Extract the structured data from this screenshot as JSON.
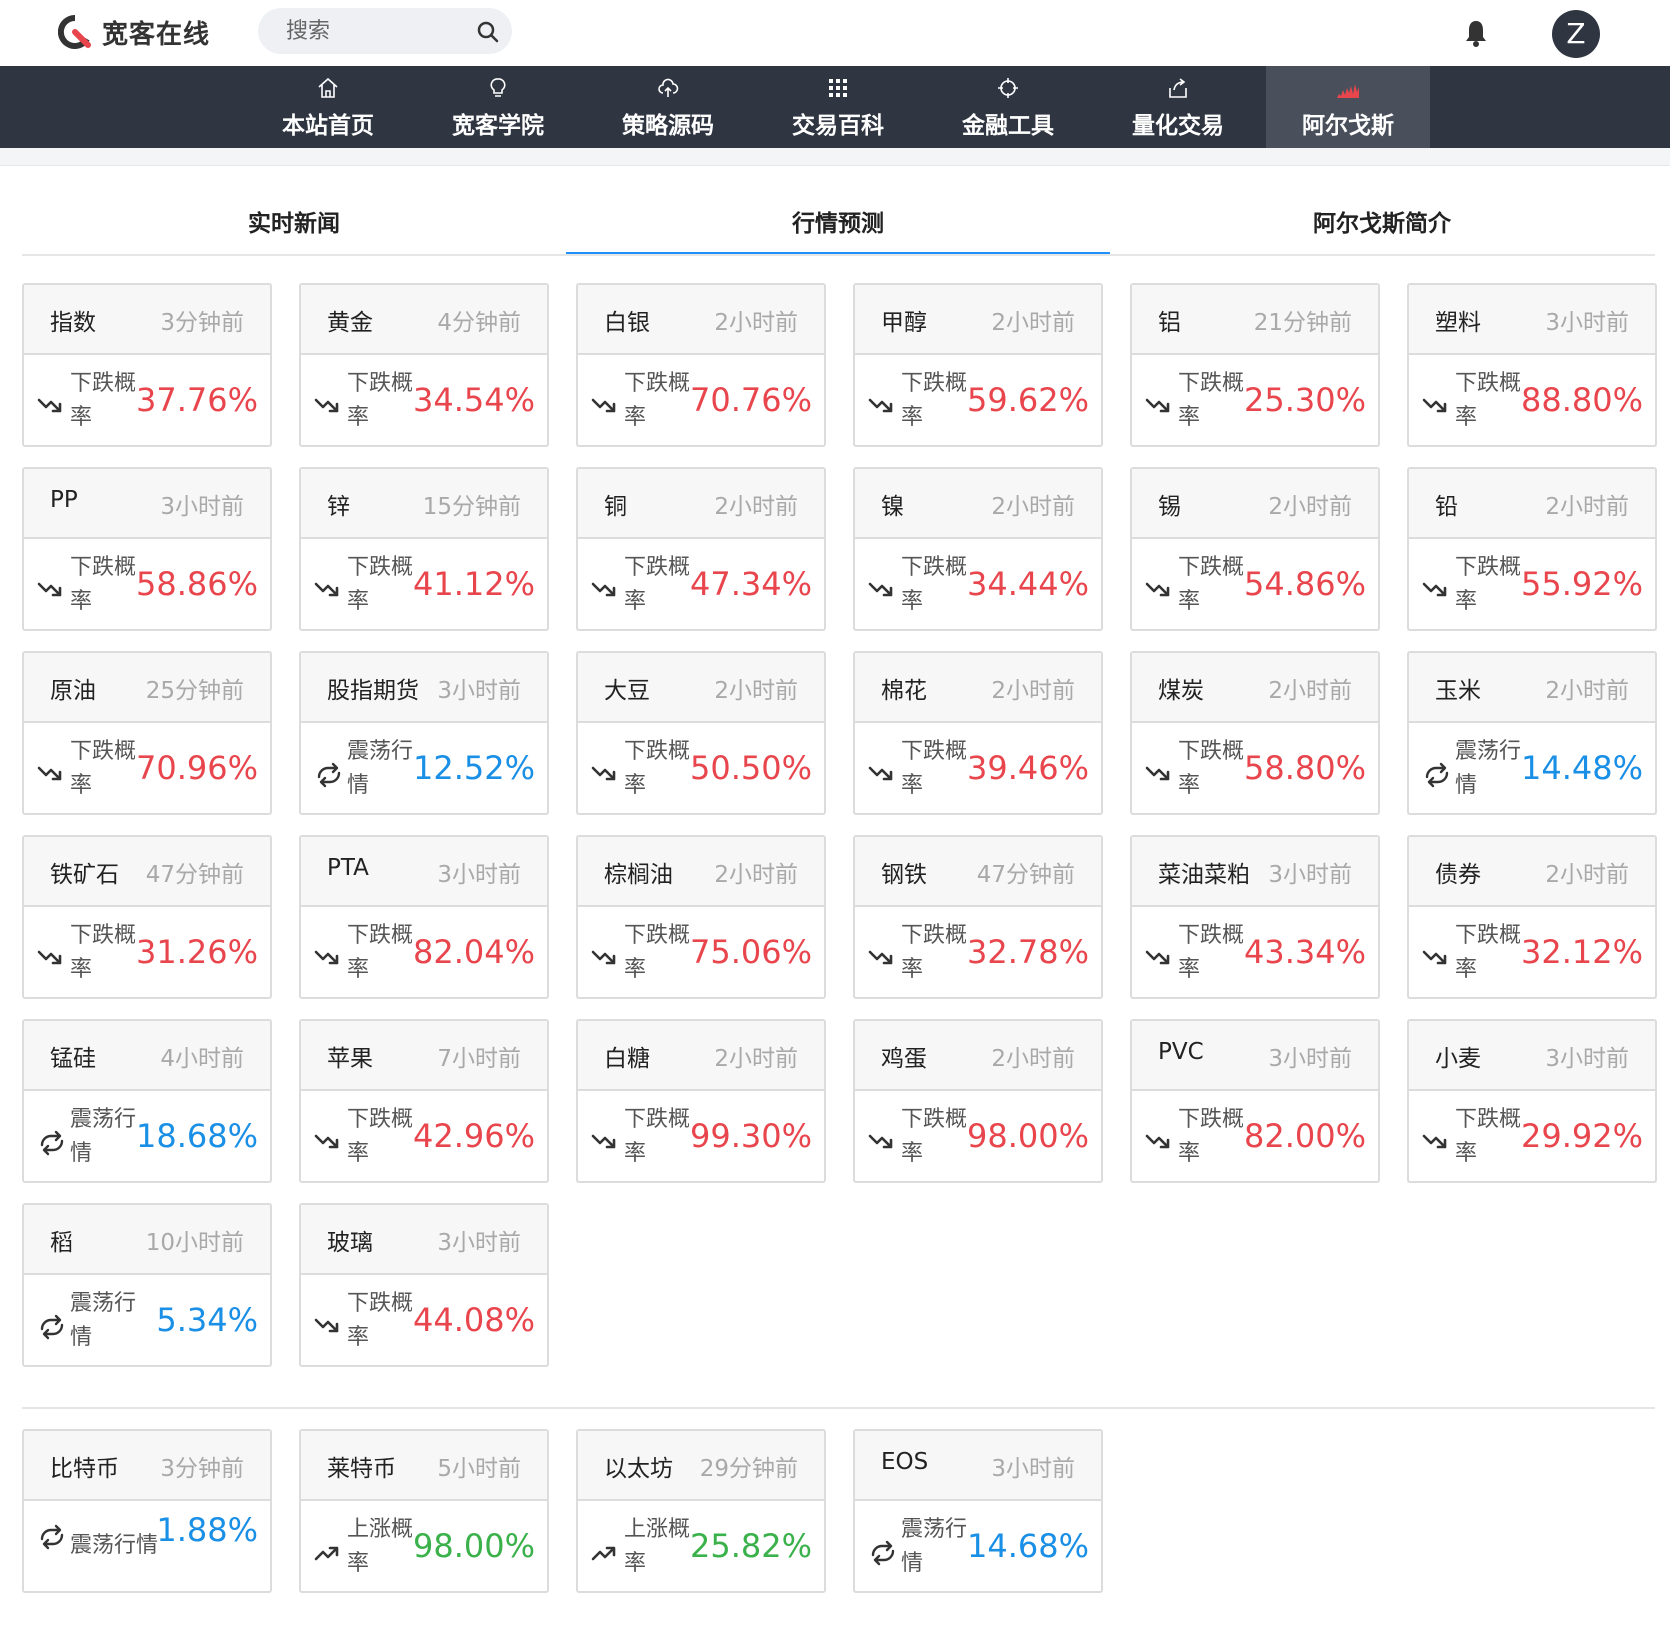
{
  "brand": {
    "name": "宽客在线"
  },
  "search": {
    "placeholder": "搜索"
  },
  "user": {
    "initial": "Z"
  },
  "nav": [
    {
      "label": "本站首页",
      "icon": "home-icon"
    },
    {
      "label": "宽客学院",
      "icon": "lightbulb-icon"
    },
    {
      "label": "策略源码",
      "icon": "cloud-upload-icon"
    },
    {
      "label": "交易百科",
      "icon": "grid-icon"
    },
    {
      "label": "金融工具",
      "icon": "crosshair-icon"
    },
    {
      "label": "量化交易",
      "icon": "share-icon"
    },
    {
      "label": "阿尔戈斯",
      "icon": "argos-chart-icon",
      "active": true
    }
  ],
  "tabs": [
    {
      "label": "实时新闻"
    },
    {
      "label": "行情预测",
      "active": true
    },
    {
      "label": "阿尔戈斯简介"
    }
  ],
  "colors": {
    "down": "#e8454d",
    "oscillate": "#1a8fe6",
    "up": "#3ab14a",
    "nav_bg": "#2f3541"
  },
  "cards": [
    {
      "name": "指数",
      "time": "3分钟前",
      "type": "down",
      "label": "下跌概率",
      "value": "37.76%"
    },
    {
      "name": "黄金",
      "time": "4分钟前",
      "type": "down",
      "label": "下跌概率",
      "value": "34.54%"
    },
    {
      "name": "白银",
      "time": "2小时前",
      "type": "down",
      "label": "下跌概率",
      "value": "70.76%"
    },
    {
      "name": "甲醇",
      "time": "2小时前",
      "type": "down",
      "label": "下跌概率",
      "value": "59.62%"
    },
    {
      "name": "铝",
      "time": "21分钟前",
      "type": "down",
      "label": "下跌概率",
      "value": "25.30%"
    },
    {
      "name": "塑料",
      "time": "3小时前",
      "type": "down",
      "label": "下跌概率",
      "value": "88.80%"
    },
    {
      "name": "PP",
      "time": "3小时前",
      "type": "down",
      "label": "下跌概率",
      "value": "58.86%"
    },
    {
      "name": "锌",
      "time": "15分钟前",
      "type": "down",
      "label": "下跌概率",
      "value": "41.12%"
    },
    {
      "name": "铜",
      "time": "2小时前",
      "type": "down",
      "label": "下跌概率",
      "value": "47.34%"
    },
    {
      "name": "镍",
      "time": "2小时前",
      "type": "down",
      "label": "下跌概率",
      "value": "34.44%"
    },
    {
      "name": "锡",
      "time": "2小时前",
      "type": "down",
      "label": "下跌概率",
      "value": "54.86%"
    },
    {
      "name": "铅",
      "time": "2小时前",
      "type": "down",
      "label": "下跌概率",
      "value": "55.92%"
    },
    {
      "name": "原油",
      "time": "25分钟前",
      "type": "down",
      "label": "下跌概率",
      "value": "70.96%"
    },
    {
      "name": "股指期货",
      "time": "3小时前",
      "type": "osc",
      "label": "震荡行情",
      "value": "12.52%"
    },
    {
      "name": "大豆",
      "time": "2小时前",
      "type": "down",
      "label": "下跌概率",
      "value": "50.50%"
    },
    {
      "name": "棉花",
      "time": "2小时前",
      "type": "down",
      "label": "下跌概率",
      "value": "39.46%"
    },
    {
      "name": "煤炭",
      "time": "2小时前",
      "type": "down",
      "label": "下跌概率",
      "value": "58.80%"
    },
    {
      "name": "玉米",
      "time": "2小时前",
      "type": "osc",
      "label": "震荡行情",
      "value": "14.48%"
    },
    {
      "name": "铁矿石",
      "time": "47分钟前",
      "type": "down",
      "label": "下跌概率",
      "value": "31.26%"
    },
    {
      "name": "PTA",
      "time": "3小时前",
      "type": "down",
      "label": "下跌概率",
      "value": "82.04%"
    },
    {
      "name": "棕榈油",
      "time": "2小时前",
      "type": "down",
      "label": "下跌概率",
      "value": "75.06%"
    },
    {
      "name": "钢铁",
      "time": "47分钟前",
      "type": "down",
      "label": "下跌概率",
      "value": "32.78%"
    },
    {
      "name": "菜油菜粕",
      "time": "3小时前",
      "type": "down",
      "label": "下跌概率",
      "value": "43.34%"
    },
    {
      "name": "债券",
      "time": "2小时前",
      "type": "down",
      "label": "下跌概率",
      "value": "32.12%"
    },
    {
      "name": "锰硅",
      "time": "4小时前",
      "type": "osc",
      "label": "震荡行情",
      "value": "18.68%"
    },
    {
      "name": "苹果",
      "time": "7小时前",
      "type": "down",
      "label": "下跌概率",
      "value": "42.96%"
    },
    {
      "name": "白糖",
      "time": "2小时前",
      "type": "down",
      "label": "下跌概率",
      "value": "99.30%"
    },
    {
      "name": "鸡蛋",
      "time": "2小时前",
      "type": "down",
      "label": "下跌概率",
      "value": "98.00%"
    },
    {
      "name": "PVC",
      "time": "3小时前",
      "type": "down",
      "label": "下跌概率",
      "value": "82.00%"
    },
    {
      "name": "小麦",
      "time": "3小时前",
      "type": "down",
      "label": "下跌概率",
      "value": "29.92%"
    },
    {
      "name": "稻",
      "time": "10小时前",
      "type": "osc",
      "label": "震荡行情",
      "value": "5.34%"
    },
    {
      "name": "玻璃",
      "time": "3小时前",
      "type": "down",
      "label": "下跌概率",
      "value": "44.08%"
    }
  ],
  "crypto_cards": [
    {
      "name": "比特币",
      "time": "3分钟前",
      "type": "osc",
      "label": "震荡行情",
      "value": "1.88%",
      "wide": true
    },
    {
      "name": "莱特币",
      "time": "5小时前",
      "type": "up",
      "label": "上涨概率",
      "value": "98.00%"
    },
    {
      "name": "以太坊",
      "time": "29分钟前",
      "type": "up",
      "label": "上涨概率",
      "value": "25.82%"
    },
    {
      "name": "EOS",
      "time": "3小时前",
      "type": "osc",
      "label": "震荡行情",
      "value": "14.68%"
    }
  ]
}
